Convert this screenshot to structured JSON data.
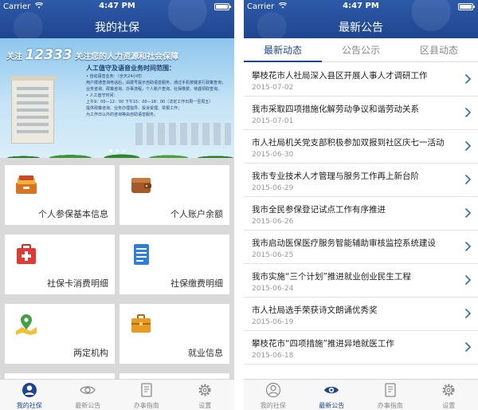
{
  "colors": {
    "nav": "#1f4590",
    "accent": "#1f4590"
  },
  "status": {
    "carrier": "Carrier",
    "time": "4:47 PM"
  },
  "left": {
    "nav_title": "我的社保",
    "banner": {
      "line1_a": "关注",
      "line1_num": "12333",
      "line1_b": "关注您的人力资源和社会保障",
      "box_heading": "人工值守及语音业务时间范围：",
      "box_lines": [
        "• 自动语音业务：（全天24小时）",
        "  用户拨通查询电话后，由拨号提示自助语音服务，通过手机按键进行政策查询；",
        "  业务咨询、政策咨询、办事流程，个人账户查询、社保缴费、待遇领取查询。",
        "• 人工值守时间：",
        "  上午9：00—12：00 下午15：00—18：00（法定工作日周一至周五）",
        "  提供政策咨询、业务办理指导、投诉受理、举报工作；",
        "  为工作日以外的咨询等由自助语音服务。"
      ],
      "slides": 3
    },
    "tiles": [
      {
        "label": "个人参保基本信息",
        "icon": "drawer-icon"
      },
      {
        "label": "个人账户余额",
        "icon": "wallet-icon"
      },
      {
        "label": "社保卡消费明细",
        "icon": "medical-kit-icon"
      },
      {
        "label": "社保缴费明细",
        "icon": "document-icon"
      },
      {
        "label": "两定机构",
        "icon": "map-pin-icon"
      },
      {
        "label": "就业信息",
        "icon": "briefcase-icon"
      }
    ],
    "tabs": [
      {
        "label": "我的社保",
        "icon": "person-icon",
        "active": true
      },
      {
        "label": "最新公告",
        "icon": "eye-icon",
        "active": false
      },
      {
        "label": "办事指南",
        "icon": "document-icon",
        "active": false
      },
      {
        "label": "设置",
        "icon": "gear-icon",
        "active": false
      }
    ]
  },
  "right": {
    "nav_title": "最新公告",
    "segments": [
      "最新动态",
      "公告公示",
      "区县动态"
    ],
    "news": [
      {
        "title": "攀枝花市人社局深入县区开展人事人才调研工作",
        "date": "2015-07-02"
      },
      {
        "title": "我市采取四项措施化解劳动争议和谐劳动关系",
        "date": "2015-07-01"
      },
      {
        "title": "市人社局机关党支部积极参加双报到社区庆七一活动",
        "date": "2015-06-30"
      },
      {
        "title": "我市专业技术人才管理与服务工作再上新台阶",
        "date": "2015-06-29"
      },
      {
        "title": "我市全民参保登记试点工作有序推进",
        "date": "2015-06-26"
      },
      {
        "title": "我市启动医保医疗服务智能辅助审核监控系统建设",
        "date": "2015-06-25"
      },
      {
        "title": "我市实施“三个计划”推进就业创业民生工程",
        "date": "2015-06-24"
      },
      {
        "title": "市人社局选手荣获诗文朗诵优秀奖",
        "date": "2015-06-19"
      },
      {
        "title": "攀枝花市“四项措施”推进异地就医工作",
        "date": "2015-06-18"
      }
    ],
    "tabs": [
      {
        "label": "我的社保",
        "icon": "person-icon",
        "active": false
      },
      {
        "label": "最新公告",
        "icon": "eye-icon",
        "active": true
      },
      {
        "label": "办事指南",
        "icon": "document-icon",
        "active": false
      },
      {
        "label": "设置",
        "icon": "gear-icon",
        "active": false
      }
    ]
  }
}
